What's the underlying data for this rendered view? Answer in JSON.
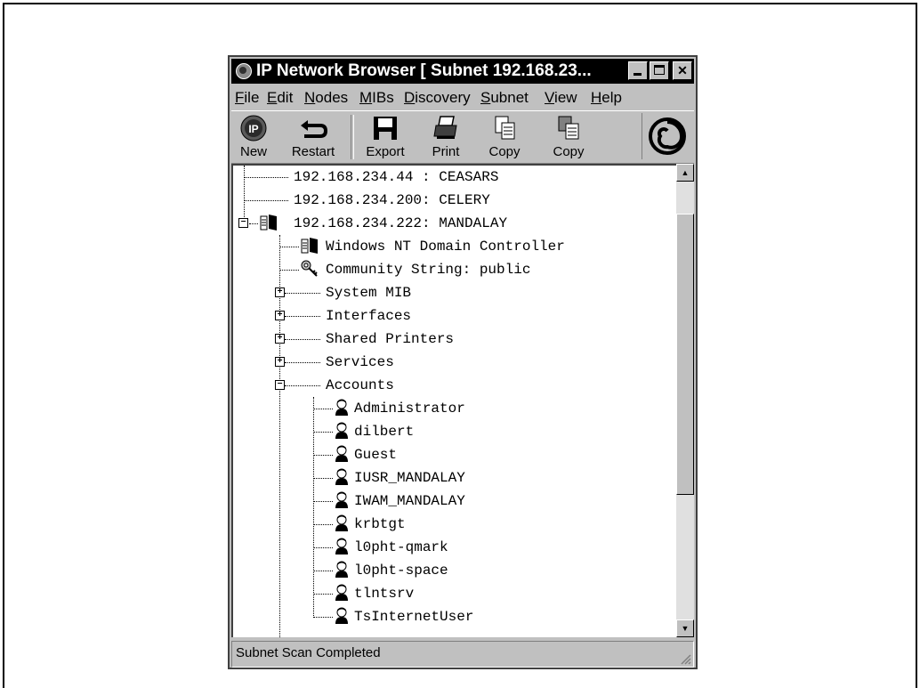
{
  "window": {
    "title": "IP Network Browser [ Subnet 192.168.23...",
    "icon": "ip-network-browser-icon"
  },
  "menu": [
    "File",
    "Edit",
    "Nodes",
    "MIBs",
    "Discovery",
    "Subnet",
    "View",
    "Help"
  ],
  "toolbar": {
    "new": "New",
    "restart": "Restart",
    "export": "Export",
    "print": "Print",
    "copy1": "Copy",
    "copy2": "Copy"
  },
  "tree": {
    "hosts": [
      "192.168.234.44 : CEASARS",
      "192.168.234.200: CELERY",
      "192.168.234.222: MANDALAY"
    ],
    "host_children": {
      "domain_controller": "Windows NT Domain Controller",
      "community": "Community String: public"
    },
    "sections": [
      "System MIB",
      "Interfaces",
      "Shared Printers",
      "Services",
      "Accounts"
    ],
    "accounts": [
      "Administrator",
      "dilbert",
      "Guest",
      "IUSR_MANDALAY",
      "IWAM_MANDALAY",
      "krbtgt",
      "l0pht-qmark",
      "l0pht-space",
      "tlntsrv",
      "TsInternetUser"
    ]
  },
  "status": {
    "text": "Subnet Scan Completed"
  }
}
